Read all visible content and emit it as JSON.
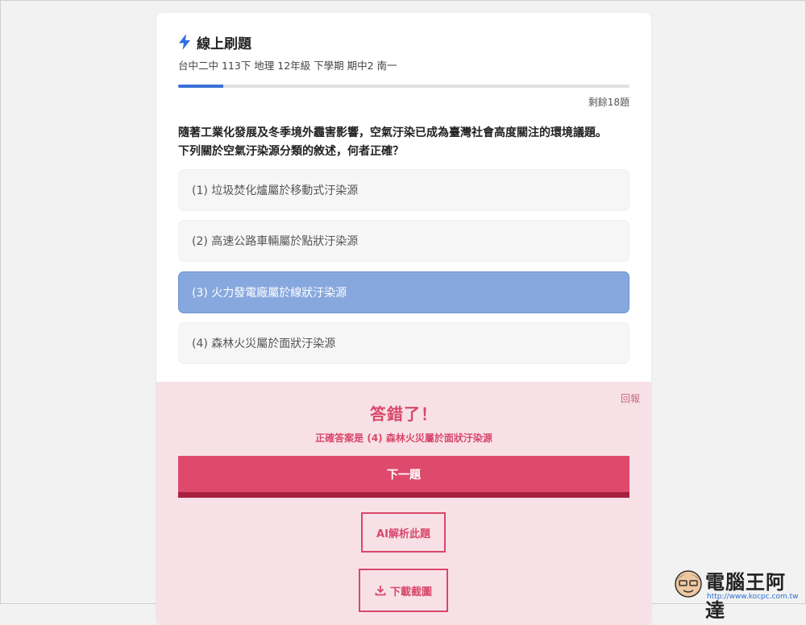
{
  "header": {
    "title": "線上刷題",
    "subtitle": "台中二中 113下 地理 12年級 下學期 期中2 南一",
    "icon": "bolt-icon"
  },
  "progress": {
    "fraction": 0.1
  },
  "remaining": "剩餘18題",
  "question": {
    "line1": "隨著工業化發展及冬季境外霾害影響，空氣汙染已成為臺灣社會高度關注的環境議題。",
    "line2": "下列關於空氣汙染源分類的敘述，何者正確？"
  },
  "options": [
    {
      "label": "(1) 垃圾焚化爐屬於移動式汙染源",
      "selected": false
    },
    {
      "label": "(2) 高速公路車輛屬於點狀汙染源",
      "selected": false
    },
    {
      "label": "(3) 火力發電廠屬於線狀汙染源",
      "selected": true
    },
    {
      "label": "(4) 森林火災屬於面狀汙染源",
      "selected": false
    }
  ],
  "feedback": {
    "report": "回報",
    "result": "答錯了！",
    "correct_answer": "正確答案是 (4) 森林火災屬於面狀汙染源",
    "next_label": "下一題",
    "ai_label": "AI解析此題",
    "download_label": "下載截圖"
  },
  "watermark": {
    "text": "電腦王阿達",
    "url": "http://www.kocpc.com.tw"
  },
  "colors": {
    "accent": "#3b6fd4",
    "selected_option": "#87a8de",
    "feedback_bg": "#f7e1e6",
    "error": "#d9476b",
    "next_button": "#de4a6c"
  }
}
